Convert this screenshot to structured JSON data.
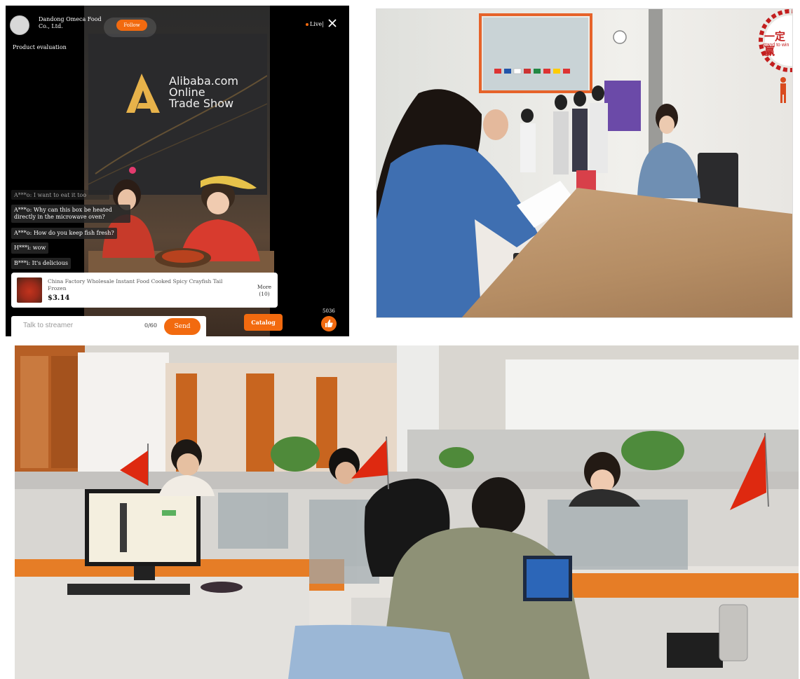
{
  "live_stream": {
    "shop_name": "Dandong Omeca Food Co., Ltd.",
    "follow_label": "Follow",
    "live_label": "Live",
    "section_label": "Product evaluation",
    "banner": {
      "logo": "alibaba-logo",
      "line1": "Alibaba.com",
      "line2": "Online",
      "line3": "Trade Show"
    },
    "comments": [
      "A***o: I want to eat it too",
      "A***o: Why can this box be heated directly in the microwave oven?",
      "A***o: How do you keep fish fresh?",
      "H***i: wow",
      "B***i: It's delicious"
    ],
    "product": {
      "title": "China Factory Wholesale Instant Food Cooked Spicy Crayfish Tail Frozen",
      "price": "$3.14",
      "more_label": "More",
      "more_count": "(10)"
    },
    "chat_input": {
      "placeholder": "Talk to streamer",
      "counter": "0/60"
    },
    "send_label": "Send",
    "catalog_label": "Catalog",
    "like_count": "5036",
    "accent_color": "#f26a0f"
  },
  "meeting_photo": {
    "sign_text": "一定赢",
    "sign_subtext": "stand to win"
  },
  "office_photo": {}
}
